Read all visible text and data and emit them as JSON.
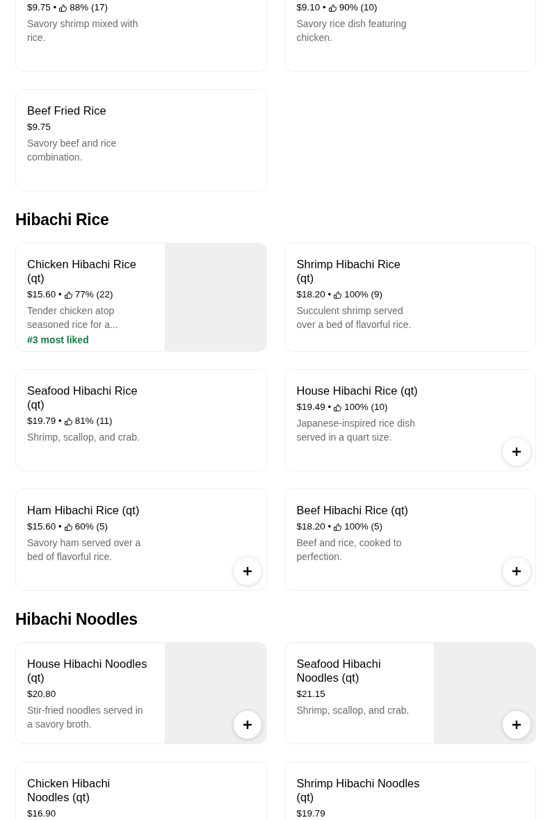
{
  "sections": [
    {
      "items": [
        {
          "price": "$9.75",
          "separator": "•",
          "rating": "88% (17)",
          "description": "Savory shrimp mixed with rice.",
          "image": false,
          "add_button": false
        },
        {
          "price": "$9.10",
          "separator": "•",
          "rating": "90% (10)",
          "description": "Savory rice dish featuring chicken.",
          "image": false,
          "add_button": false
        },
        {
          "name": "Beef Fried Rice",
          "price": "$9.75",
          "description": "Savory beef and rice combination.",
          "image": false,
          "add_button": false
        }
      ]
    },
    {
      "title": "Hibachi Rice",
      "items": [
        {
          "name": "Chicken Hibachi Rice (qt)",
          "price": "$15.60",
          "separator": "•",
          "rating": "77% (22)",
          "description": "Tender chicken atop seasoned rice for a...",
          "badge": "#3 most liked",
          "image": true,
          "add_button": false
        },
        {
          "name": "Shrimp Hibachi Rice (qt)",
          "price": "$18.20",
          "separator": "•",
          "rating": "100% (9)",
          "description": "Succulent shrimp served over a bed of flavorful rice.",
          "image": false,
          "add_button": false
        },
        {
          "name": "Seafood Hibachi Rice (qt)",
          "price": "$19.79",
          "separator": "•",
          "rating": "81% (11)",
          "description": "Shrimp, scallop, and crab.",
          "image": false,
          "add_button": false
        },
        {
          "name": "House Hibachi Rice (qt)",
          "price": "$19.49",
          "separator": "•",
          "rating": "100% (10)",
          "description": "Japanese-inspired rice dish served in a quart size.",
          "image": false,
          "add_button": true
        },
        {
          "name": "Ham Hibachi Rice (qt)",
          "price": "$15.60",
          "separator": "•",
          "rating": "60% (5)",
          "description": "Savory ham served over a bed of flavorful rice.",
          "image": false,
          "add_button": true
        },
        {
          "name": "Beef Hibachi Rice (qt)",
          "price": "$18.20",
          "separator": "•",
          "rating": "100% (5)",
          "description": "Beef and rice, cooked to perfection.",
          "image": false,
          "add_button": true
        }
      ]
    },
    {
      "title": "Hibachi Noodles",
      "items": [
        {
          "name": "House Hibachi Noodles (qt)",
          "price": "$20.80",
          "description": "Stir-fried noodles served in a savory broth.",
          "image": true,
          "add_button": true
        },
        {
          "name": "Seafood Hibachi Noodles (qt)",
          "price": "$21.15",
          "description": "Shrimp, scallop, and crab.",
          "image": true,
          "add_button": true
        },
        {
          "name": "Chicken Hibachi Noodles (qt)",
          "price": "$16.90",
          "image": false
        },
        {
          "name": "Shrimp Hibachi Noodles (qt)",
          "price": "$19.79",
          "image": false
        }
      ]
    }
  ]
}
